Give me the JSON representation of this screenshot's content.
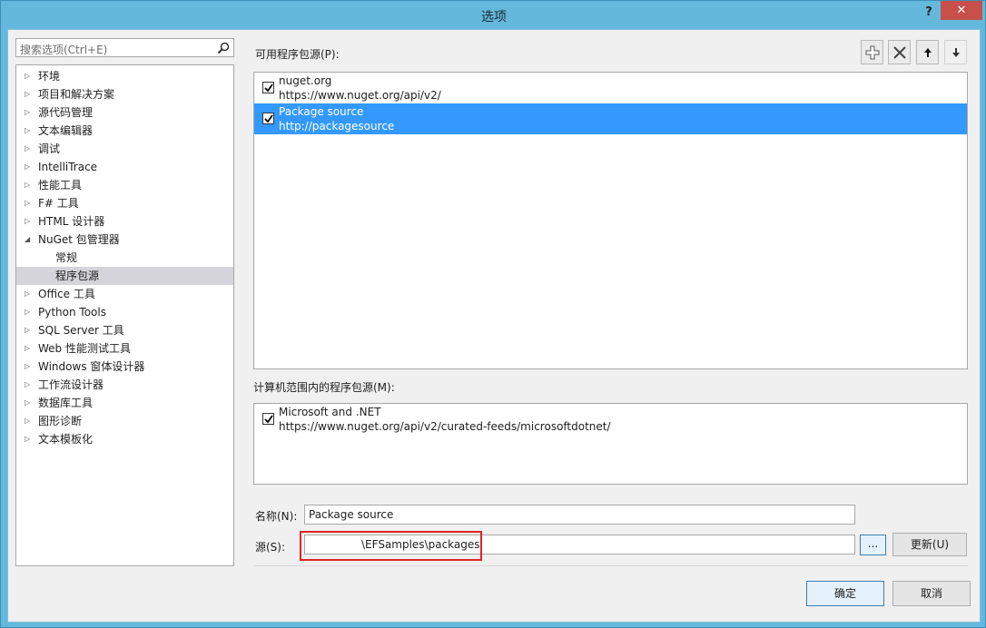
{
  "window": {
    "title": "选项",
    "help": "?",
    "close": "✕"
  },
  "search": {
    "placeholder": "搜索选项(Ctrl+E)"
  },
  "tree": [
    {
      "label": "环境",
      "expanded": false,
      "level": 0
    },
    {
      "label": "项目和解决方案",
      "expanded": false,
      "level": 0
    },
    {
      "label": "源代码管理",
      "expanded": false,
      "level": 0
    },
    {
      "label": "文本编辑器",
      "expanded": false,
      "level": 0
    },
    {
      "label": "调试",
      "expanded": false,
      "level": 0
    },
    {
      "label": "IntelliTrace",
      "expanded": false,
      "level": 0
    },
    {
      "label": "性能工具",
      "expanded": false,
      "level": 0
    },
    {
      "label": "F# 工具",
      "expanded": false,
      "level": 0
    },
    {
      "label": "HTML 设计器",
      "expanded": false,
      "level": 0
    },
    {
      "label": "NuGet 包管理器",
      "expanded": true,
      "level": 0
    },
    {
      "label": "常规",
      "level": 1
    },
    {
      "label": "程序包源",
      "level": 1,
      "selected": true
    },
    {
      "label": "Office 工具",
      "expanded": false,
      "level": 0
    },
    {
      "label": "Python Tools",
      "expanded": false,
      "level": 0
    },
    {
      "label": "SQL Server 工具",
      "expanded": false,
      "level": 0
    },
    {
      "label": "Web 性能测试工具",
      "expanded": false,
      "level": 0
    },
    {
      "label": "Windows 窗体设计器",
      "expanded": false,
      "level": 0
    },
    {
      "label": "工作流设计器",
      "expanded": false,
      "level": 0
    },
    {
      "label": "数据库工具",
      "expanded": false,
      "level": 0
    },
    {
      "label": "图形诊断",
      "expanded": false,
      "level": 0
    },
    {
      "label": "文本模板化",
      "expanded": false,
      "level": 0
    }
  ],
  "available": {
    "label": "可用程序包源(P):",
    "sources": [
      {
        "name": "nuget.org",
        "url": "https://www.nuget.org/api/v2/",
        "checked": true,
        "selected": false
      },
      {
        "name": "Package source",
        "url": "http://packagesource",
        "checked": true,
        "selected": true
      }
    ]
  },
  "machine": {
    "label": "计算机范围内的程序包源(M):",
    "sources": [
      {
        "name": "Microsoft and .NET",
        "url": "https://www.nuget.org/api/v2/curated-feeds/microsoftdotnet/",
        "checked": true
      }
    ]
  },
  "form": {
    "name_label": "名称(N):",
    "name_value": "Package source",
    "source_label": "源(S):",
    "source_value": "\\EFSamples\\packages",
    "browse": "...",
    "update": "更新(U)"
  },
  "footer": {
    "ok": "确定",
    "cancel": "取消"
  },
  "colors": {
    "selection": "#3399ff",
    "highlight": "#e0232a",
    "titlebar": "#63b8dc"
  },
  "icons": {
    "search": "search-icon",
    "add": "plus-icon",
    "remove": "x-icon",
    "up": "arrow-up-icon",
    "down": "arrow-down-icon"
  }
}
